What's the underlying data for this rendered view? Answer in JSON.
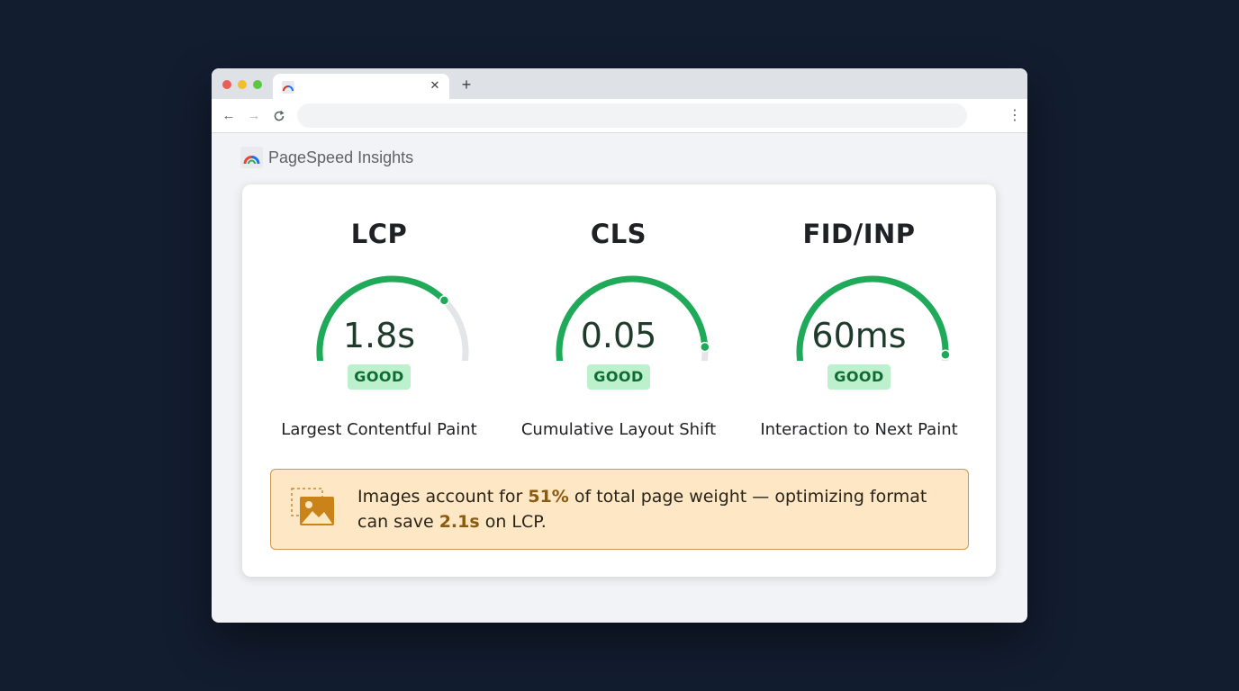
{
  "browser": {
    "tab_title": "",
    "address": ""
  },
  "brand": {
    "name": "PageSpeed Insights"
  },
  "metrics": [
    {
      "abbr": "LCP",
      "value": "1.8s",
      "status": "GOOD",
      "name": "Largest Contentful Paint",
      "gauge_fill": 0.72
    },
    {
      "abbr": "CLS",
      "value": "0.05",
      "status": "GOOD",
      "name": "Cumulative Layout Shift",
      "gauge_fill": 0.92
    },
    {
      "abbr": "FID/INP",
      "value": "60ms",
      "status": "GOOD",
      "name": "Interaction to Next Paint",
      "gauge_fill": 0.95
    }
  ],
  "alert": {
    "text_1": "Images account for ",
    "highlight_1": "51%",
    "text_2": " of total page weight — optimizing format can save ",
    "highlight_2": "2.1s",
    "text_3": " on LCP."
  },
  "colors": {
    "good": "#1faa59",
    "track": "#e3e5e8",
    "badge_bg": "#bdf0cd",
    "alert_bg": "#fde7c4",
    "alert_border": "#c79a4d",
    "page_bg": "#131d30"
  }
}
